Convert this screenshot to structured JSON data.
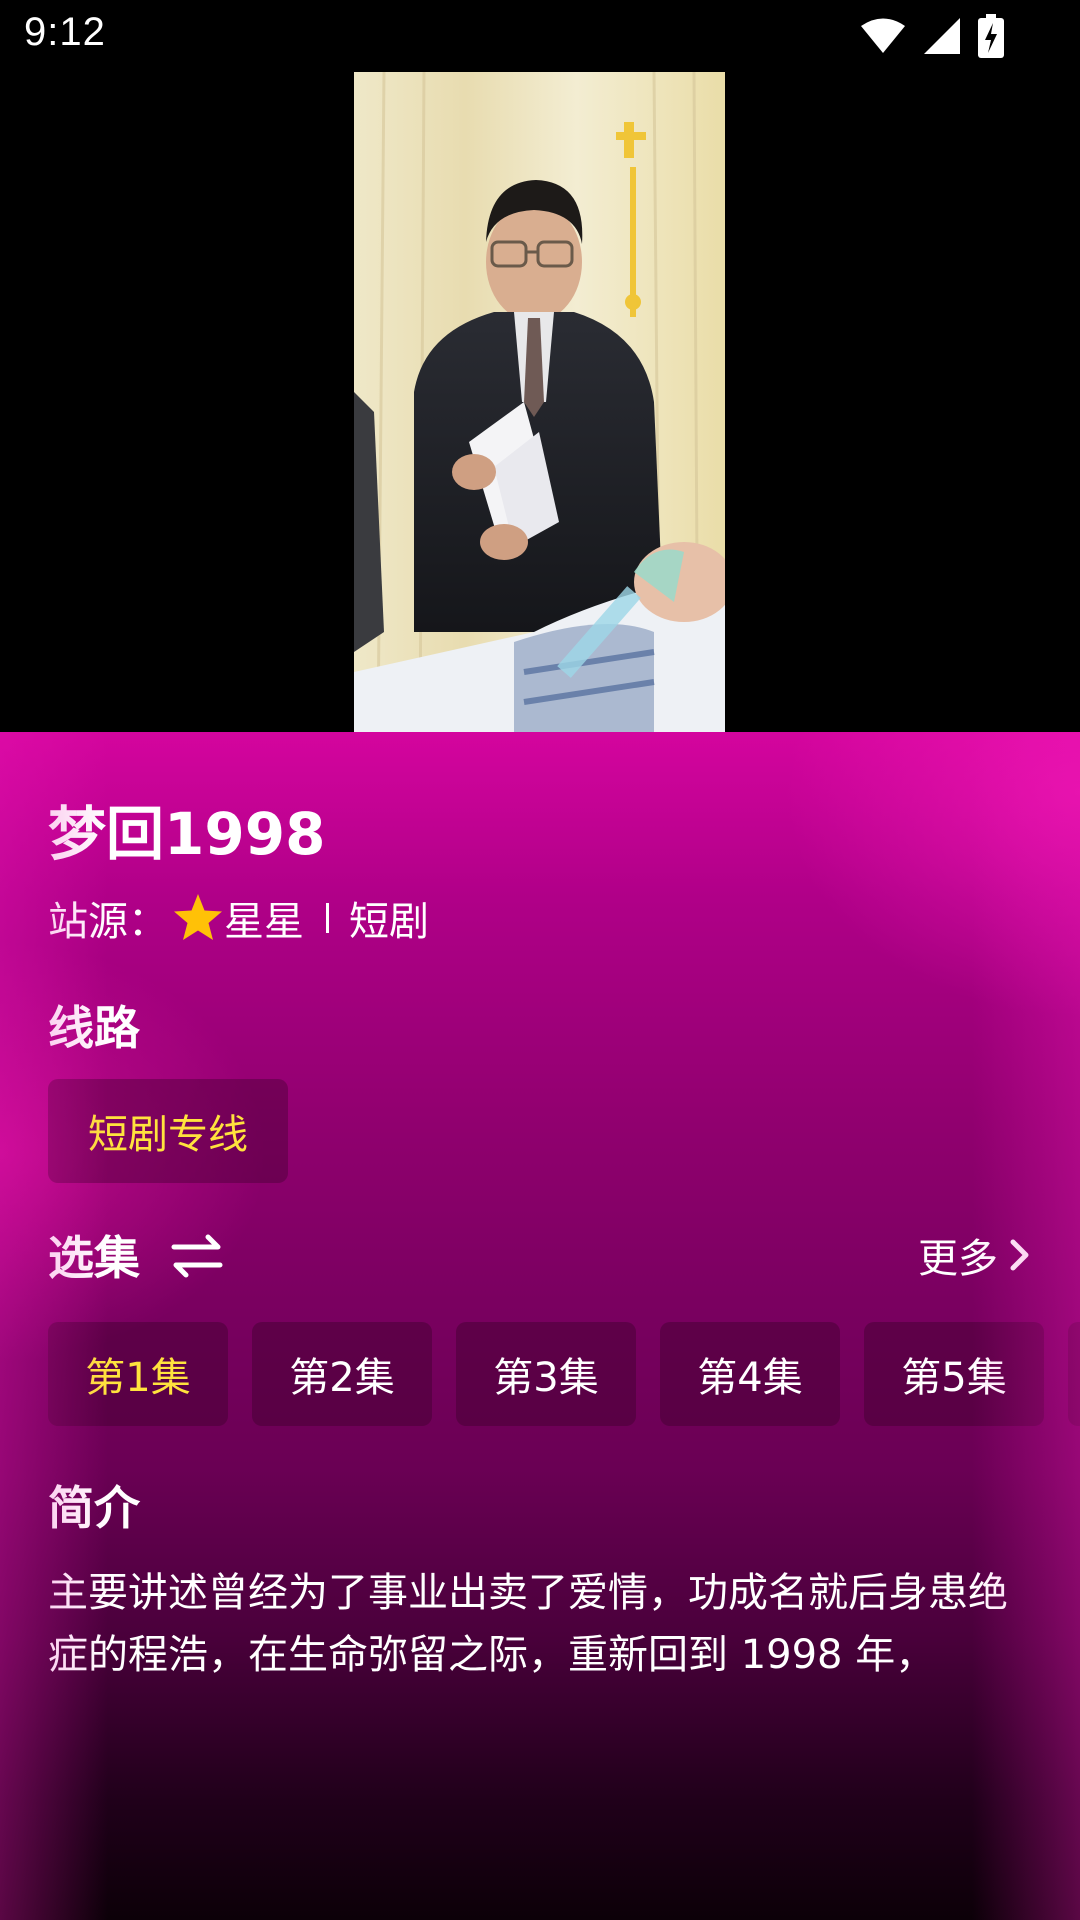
{
  "status_bar": {
    "time": "9:12",
    "icons": [
      "wifi-icon",
      "cellular-signal-icon",
      "battery-charging-icon"
    ]
  },
  "video": {
    "description_icon": "video-frame"
  },
  "details": {
    "title": "梦回1998",
    "source_label": "站源：",
    "source_name": "星星",
    "source_category": "短剧"
  },
  "routes": {
    "heading": "线路",
    "items": [
      {
        "label": "短剧专线",
        "selected": true
      }
    ]
  },
  "episodes": {
    "heading": "选集",
    "more_label": "更多",
    "items": [
      {
        "label": "第1集",
        "selected": true
      },
      {
        "label": "第2集",
        "selected": false
      },
      {
        "label": "第3集",
        "selected": false
      },
      {
        "label": "第4集",
        "selected": false
      },
      {
        "label": "第5集",
        "selected": false
      }
    ]
  },
  "synopsis": {
    "heading": "简介",
    "text": "主要讲述曾经为了事业出卖了爱情，功成名就后身患绝症的程浩，在生命弥留之际，重新回到 1998 年，"
  },
  "colors": {
    "accent_selected": "#ffe33d",
    "panel_top": "#d4059e",
    "panel_bottom": "#0c0008"
  }
}
